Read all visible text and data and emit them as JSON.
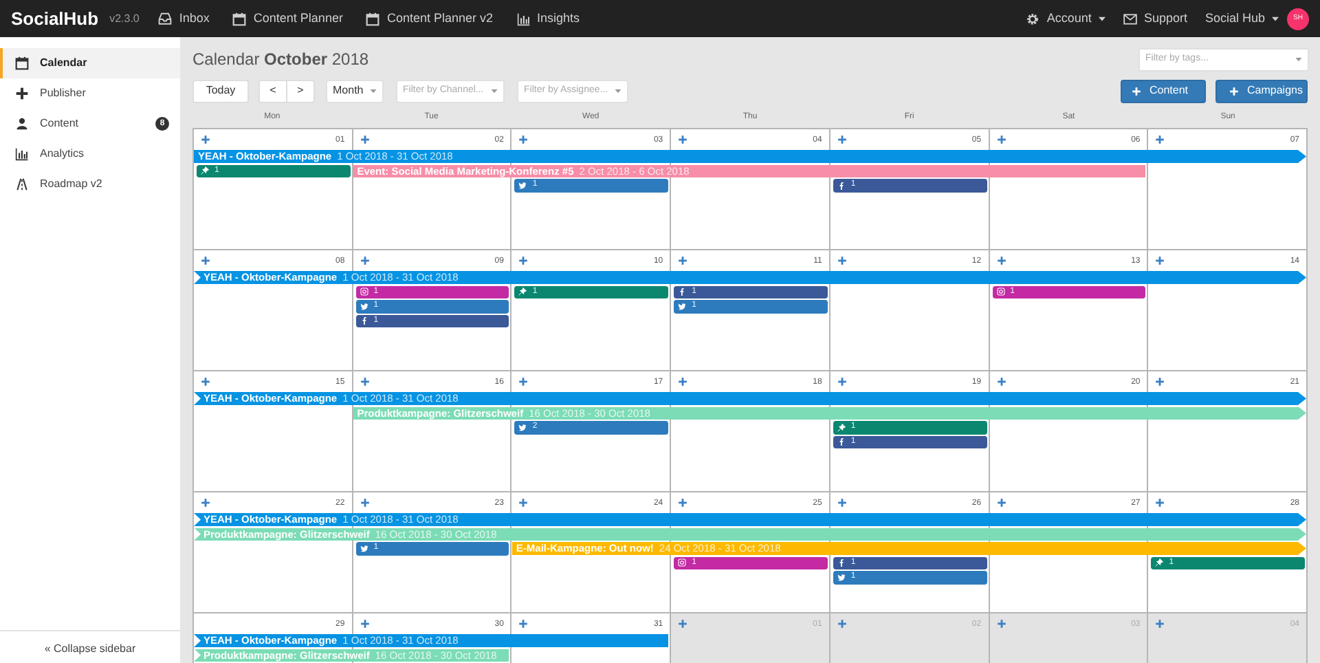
{
  "app": {
    "logo": "Social**Hub**",
    "version": "v2.3.0"
  },
  "nav": [
    {
      "label": "Inbox"
    },
    {
      "label": "Content Planner"
    },
    {
      "label": "Content Planner v2"
    },
    {
      "label": "Insights"
    }
  ],
  "user_menu": [
    {
      "label": "Account",
      "dropdown": true
    },
    {
      "label": "Support",
      "dropdown": false
    },
    {
      "label": "Social Hub",
      "dropdown": true
    }
  ],
  "avatar": "SH",
  "sidebar": {
    "items": [
      {
        "label": "Calendar",
        "selected": true
      },
      {
        "label": "Publisher",
        "selected": false
      },
      {
        "label": "Content",
        "selected": false,
        "badge": "8"
      },
      {
        "label": "Analytics",
        "selected": false
      },
      {
        "label": "Roadmap v2",
        "selected": false
      }
    ],
    "collapse": "« Collapse sidebar"
  },
  "header": {
    "title": "Calendar **October** 2018",
    "tag_filter": {
      "placeholder": "Filter by tags..."
    }
  },
  "toolbar": {
    "today": "Today",
    "prev": "<",
    "next": ">",
    "view": "Month",
    "channel_filter": {
      "placeholder": "Filter by Channel..."
    },
    "assignee_filter": {
      "placeholder": "Filter by Assignee..."
    },
    "actions": [
      "Content",
      "Campaigns"
    ]
  },
  "weekdays": [
    "Mon",
    "Tue",
    "Wed",
    "Thu",
    "Fri",
    "Sat",
    "Sun"
  ],
  "weeks": [
    {
      "days": [
        {
          "number": "01",
          "in_month": true,
          "add_button": true,
          "posts": [
            {
              "kind": "pin",
              "count": "1",
              "color": "#0b8770"
            }
          ]
        },
        {
          "number": "02",
          "in_month": true,
          "add_button": true
        },
        {
          "number": "03",
          "in_month": true,
          "add_button": true,
          "posts": [
            {
              "kind": "twitter",
              "count": "1",
              "color": "#2d7bbd"
            }
          ]
        },
        {
          "number": "04",
          "in_month": true,
          "add_button": true
        },
        {
          "number": "05",
          "in_month": true,
          "add_button": true,
          "posts": [
            {
              "kind": "facebook",
              "count": "1",
              "color": "#3b5998"
            }
          ]
        },
        {
          "number": "06",
          "in_month": true,
          "add_button": true
        },
        {
          "number": "07",
          "in_month": true,
          "add_button": true
        }
      ],
      "campaigns": [
        {
          "title": "YEAH - Oktober-Kampagne",
          "dates": "1 Oct 2018 - 31 Oct 2018",
          "color": "#0693e3"
        },
        {
          "title": "Event: Social Media Marketing-Konferenz #5",
          "dates": "2 Oct 2018 - 6 Oct 2018",
          "color": "#f78da7"
        }
      ]
    },
    {
      "days": [
        {
          "number": "08",
          "in_month": true,
          "add_button": true
        },
        {
          "number": "09",
          "in_month": true,
          "add_button": true,
          "posts": [
            {
              "kind": "instagram",
              "count": "1",
              "color": "#c32aa3"
            },
            {
              "kind": "twitter",
              "count": "1",
              "color": "#2d7bbd"
            },
            {
              "kind": "facebook",
              "count": "1",
              "color": "#3b5998"
            }
          ]
        },
        {
          "number": "10",
          "in_month": true,
          "add_button": true,
          "posts": [
            {
              "kind": "pin",
              "count": "1",
              "color": "#0b8770"
            }
          ]
        },
        {
          "number": "11",
          "in_month": true,
          "add_button": true,
          "posts": [
            {
              "kind": "facebook",
              "count": "1",
              "color": "#3b5998"
            },
            {
              "kind": "twitter",
              "count": "1",
              "color": "#2d7bbd"
            }
          ]
        },
        {
          "number": "12",
          "in_month": true,
          "add_button": true
        },
        {
          "number": "13",
          "in_month": true,
          "add_button": true,
          "posts": [
            {
              "kind": "instagram",
              "count": "1",
              "color": "#c32aa3"
            }
          ]
        },
        {
          "number": "14",
          "in_month": true,
          "add_button": true
        }
      ],
      "campaigns": [
        {
          "title": "YEAH - Oktober-Kampagne",
          "dates": "1 Oct 2018 - 31 Oct 2018",
          "color": "#0693e3"
        }
      ]
    },
    {
      "days": [
        {
          "number": "15",
          "in_month": true,
          "add_button": true
        },
        {
          "number": "16",
          "in_month": true,
          "add_button": true
        },
        {
          "number": "17",
          "in_month": true,
          "add_button": true,
          "posts": [
            {
              "kind": "twitter",
              "count": "2",
              "color": "#2d7bbd"
            }
          ]
        },
        {
          "number": "18",
          "in_month": true,
          "add_button": true
        },
        {
          "number": "19",
          "in_month": true,
          "add_button": true,
          "posts": [
            {
              "kind": "pin",
              "count": "1",
              "color": "#0b8770"
            },
            {
              "kind": "facebook",
              "count": "1",
              "color": "#3b5998"
            }
          ]
        },
        {
          "number": "20",
          "in_month": true,
          "add_button": true
        },
        {
          "number": "21",
          "in_month": true,
          "add_button": true
        }
      ],
      "campaigns": [
        {
          "title": "YEAH - Oktober-Kampagne",
          "dates": "1 Oct 2018 - 31 Oct 2018",
          "color": "#0693e3"
        },
        {
          "title": "Produktkampagne: Glitzerschweif",
          "dates": "16 Oct 2018 - 30 Oct 2018",
          "color": "#7bdcb5"
        }
      ]
    },
    {
      "days": [
        {
          "number": "22",
          "in_month": true,
          "add_button": true
        },
        {
          "number": "23",
          "in_month": true,
          "add_button": true,
          "posts": [
            {
              "kind": "twitter",
              "count": "1",
              "color": "#2d7bbd"
            }
          ]
        },
        {
          "number": "24",
          "in_month": true,
          "add_button": true
        },
        {
          "number": "25",
          "in_month": true,
          "add_button": true,
          "posts": [
            {
              "kind": "instagram",
              "count": "1",
              "color": "#c32aa3"
            }
          ]
        },
        {
          "number": "26",
          "in_month": true,
          "add_button": true,
          "posts": [
            {
              "kind": "facebook",
              "count": "1",
              "color": "#3b5998"
            },
            {
              "kind": "twitter",
              "count": "1",
              "color": "#2d7bbd"
            }
          ]
        },
        {
          "number": "27",
          "in_month": true,
          "add_button": true
        },
        {
          "number": "28",
          "in_month": true,
          "add_button": true,
          "posts": [
            {
              "kind": "pin",
              "count": "1",
              "color": "#0b8770"
            }
          ]
        }
      ],
      "campaigns": [
        {
          "title": "YEAH - Oktober-Kampagne",
          "dates": "1 Oct 2018 - 31 Oct 2018",
          "color": "#0693e3"
        },
        {
          "title": "Produktkampagne: Glitzerschweif",
          "dates": "16 Oct 2018 - 30 Oct 2018",
          "color": "#7bdcb5"
        },
        {
          "title": "E-Mail-Kampagne: Out now!",
          "dates": "24 Oct 2018 - 31 Oct 2018",
          "color": "#fcb900"
        }
      ]
    },
    {
      "days": [
        {
          "number": "29",
          "in_month": true,
          "add_button": false
        },
        {
          "number": "30",
          "in_month": true,
          "add_button": true
        },
        {
          "number": "31",
          "in_month": true,
          "add_button": true
        },
        {
          "number": "01",
          "in_month": false,
          "add_button": true
        },
        {
          "number": "02",
          "in_month": false,
          "add_button": true
        },
        {
          "number": "03",
          "in_month": false,
          "add_button": true
        },
        {
          "number": "04",
          "in_month": false,
          "add_button": true
        }
      ],
      "campaigns": [
        {
          "title": "YEAH - Oktober-Kampagne",
          "dates": "1 Oct 2018 - 31 Oct 2018",
          "color": "#0693e3"
        },
        {
          "title": "Produktkampagne: Glitzerschweif",
          "dates": "16 Oct 2018 - 30 Oct 2018",
          "color": "#7bdcb5"
        }
      ]
    }
  ]
}
